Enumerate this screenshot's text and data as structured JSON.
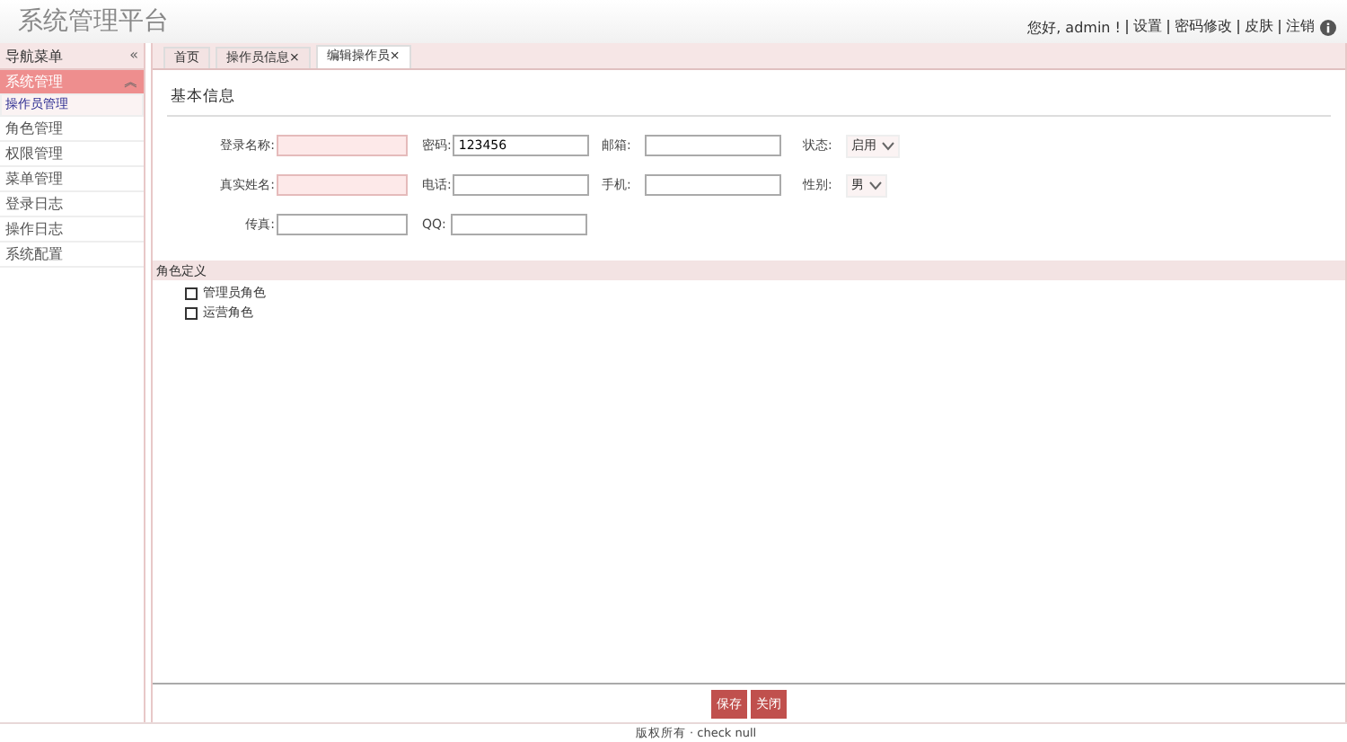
{
  "header": {
    "title": "系统管理平台",
    "greeting": "您好, admin !",
    "links": [
      "设置",
      "密码修改",
      "皮肤"
    ],
    "logout": "注销"
  },
  "sidebar": {
    "title": "导航菜单",
    "collapse": "«",
    "group": {
      "label": "系统管理",
      "expanded": true,
      "toggle": "︽"
    },
    "items": [
      {
        "label": "操作员管理",
        "selected": true
      },
      {
        "label": "角色管理",
        "selected": false
      },
      {
        "label": "权限管理",
        "selected": false
      },
      {
        "label": "菜单管理",
        "selected": false
      },
      {
        "label": "登录日志",
        "selected": false
      },
      {
        "label": "操作日志",
        "selected": false
      },
      {
        "label": "系统配置",
        "selected": false
      }
    ]
  },
  "tabs": [
    {
      "label": "首页",
      "selected": false
    },
    {
      "label": "操作员信息",
      "selected": false,
      "close": "×"
    },
    {
      "label": "编辑操作员",
      "selected": true,
      "close": "×"
    }
  ],
  "form": {
    "section": "基本信息",
    "rows": [
      [
        {
          "kind": "text",
          "label": "登录名称:",
          "required": true
        },
        {
          "kind": "text",
          "label": "密码:",
          "value": "123456",
          "required": false
        },
        {
          "kind": "text",
          "label": "邮箱:",
          "required": false
        },
        {
          "kind": "select",
          "label": "状态:",
          "value": "启用"
        }
      ],
      [
        {
          "kind": "text",
          "label": "真实姓名:",
          "required": true
        },
        {
          "kind": "text",
          "label": "电话:",
          "required": false
        },
        {
          "kind": "text",
          "label": "手机:",
          "required": false
        },
        {
          "kind": "select",
          "label": "性别:",
          "value": "男"
        }
      ],
      [
        {
          "kind": "text",
          "label": "传真:",
          "required": false
        },
        {
          "kind": "text",
          "label": "QQ:",
          "required": false
        }
      ]
    ]
  },
  "roles": {
    "section": "角色定义",
    "items": [
      {
        "label": "管理员角色",
        "checked": false
      },
      {
        "label": "运营角色",
        "checked": false
      }
    ]
  },
  "buttons": [
    "保存",
    "关闭"
  ],
  "footer": "版权所有 · check null"
}
